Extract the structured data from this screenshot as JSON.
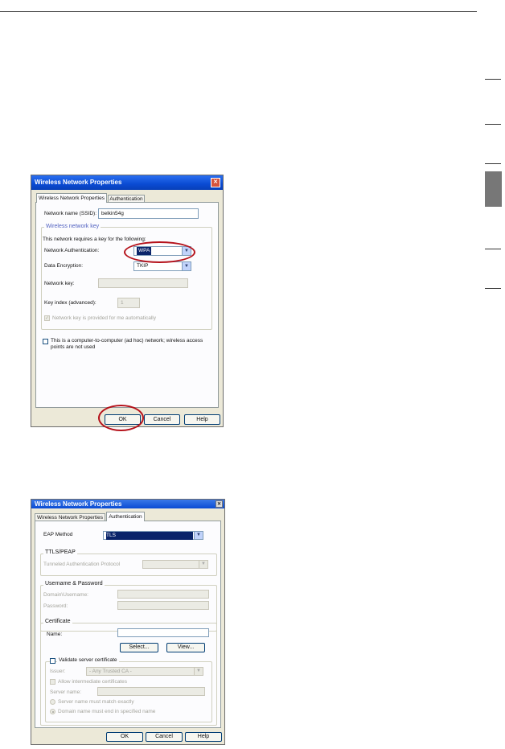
{
  "dialog1": {
    "title": "Wireless Network Properties",
    "close_glyph": "✕",
    "tabs": [
      "Wireless Network Properties",
      "Authentication"
    ],
    "network_name_label": "Network name (SSID):",
    "network_name_value": "belkin54g",
    "group_title": "Wireless network key",
    "group_desc": "This network requires a key for the following:",
    "auth_label": "Network Authentication:",
    "auth_value": "WPA",
    "encryption_label": "Data Encryption:",
    "encryption_value": "TKIP",
    "network_key_label": "Network key:",
    "key_index_label": "Key index (advanced):",
    "key_index_value": "1",
    "auto_key_label": "Network key is provided for me automatically",
    "adhoc_label": "This is a computer-to-computer (ad hoc) network; wireless access points are not used",
    "buttons": {
      "ok": "OK",
      "cancel": "Cancel",
      "help": "Help"
    }
  },
  "dialog2": {
    "title": "Wireless Network Properties",
    "close_glyph": "✕",
    "tabs": [
      "Wireless Network Properties",
      "Authentication"
    ],
    "eap_label": "EAP Method",
    "eap_value": "TLS",
    "ttls_group": "TTLS/PEAP",
    "tunneled_label": "Tunneled Authentication Protocol",
    "userpass_group": "Username & Password",
    "domain_label": "Domain\\Username:",
    "password_label": "Password:",
    "cert_group": "Certificate",
    "name_label": "Name:",
    "select_btn": "Select...",
    "view_btn": "View...",
    "validate_label": "Validate server certificate",
    "issuer_label": "Issuer:",
    "issuer_value": "- Any Trusted CA -",
    "allow_label": "Allow intermediate certificates",
    "server_name_label": "Server name:",
    "radio1_label": "Server name must match exactly",
    "radio2_label": "Domain name must end in specified name",
    "buttons": {
      "ok": "OK",
      "cancel": "Cancel",
      "help": "Help"
    }
  },
  "colors": {
    "accent_ring": "#b5121b",
    "titlebar": "#0a4bd3"
  }
}
